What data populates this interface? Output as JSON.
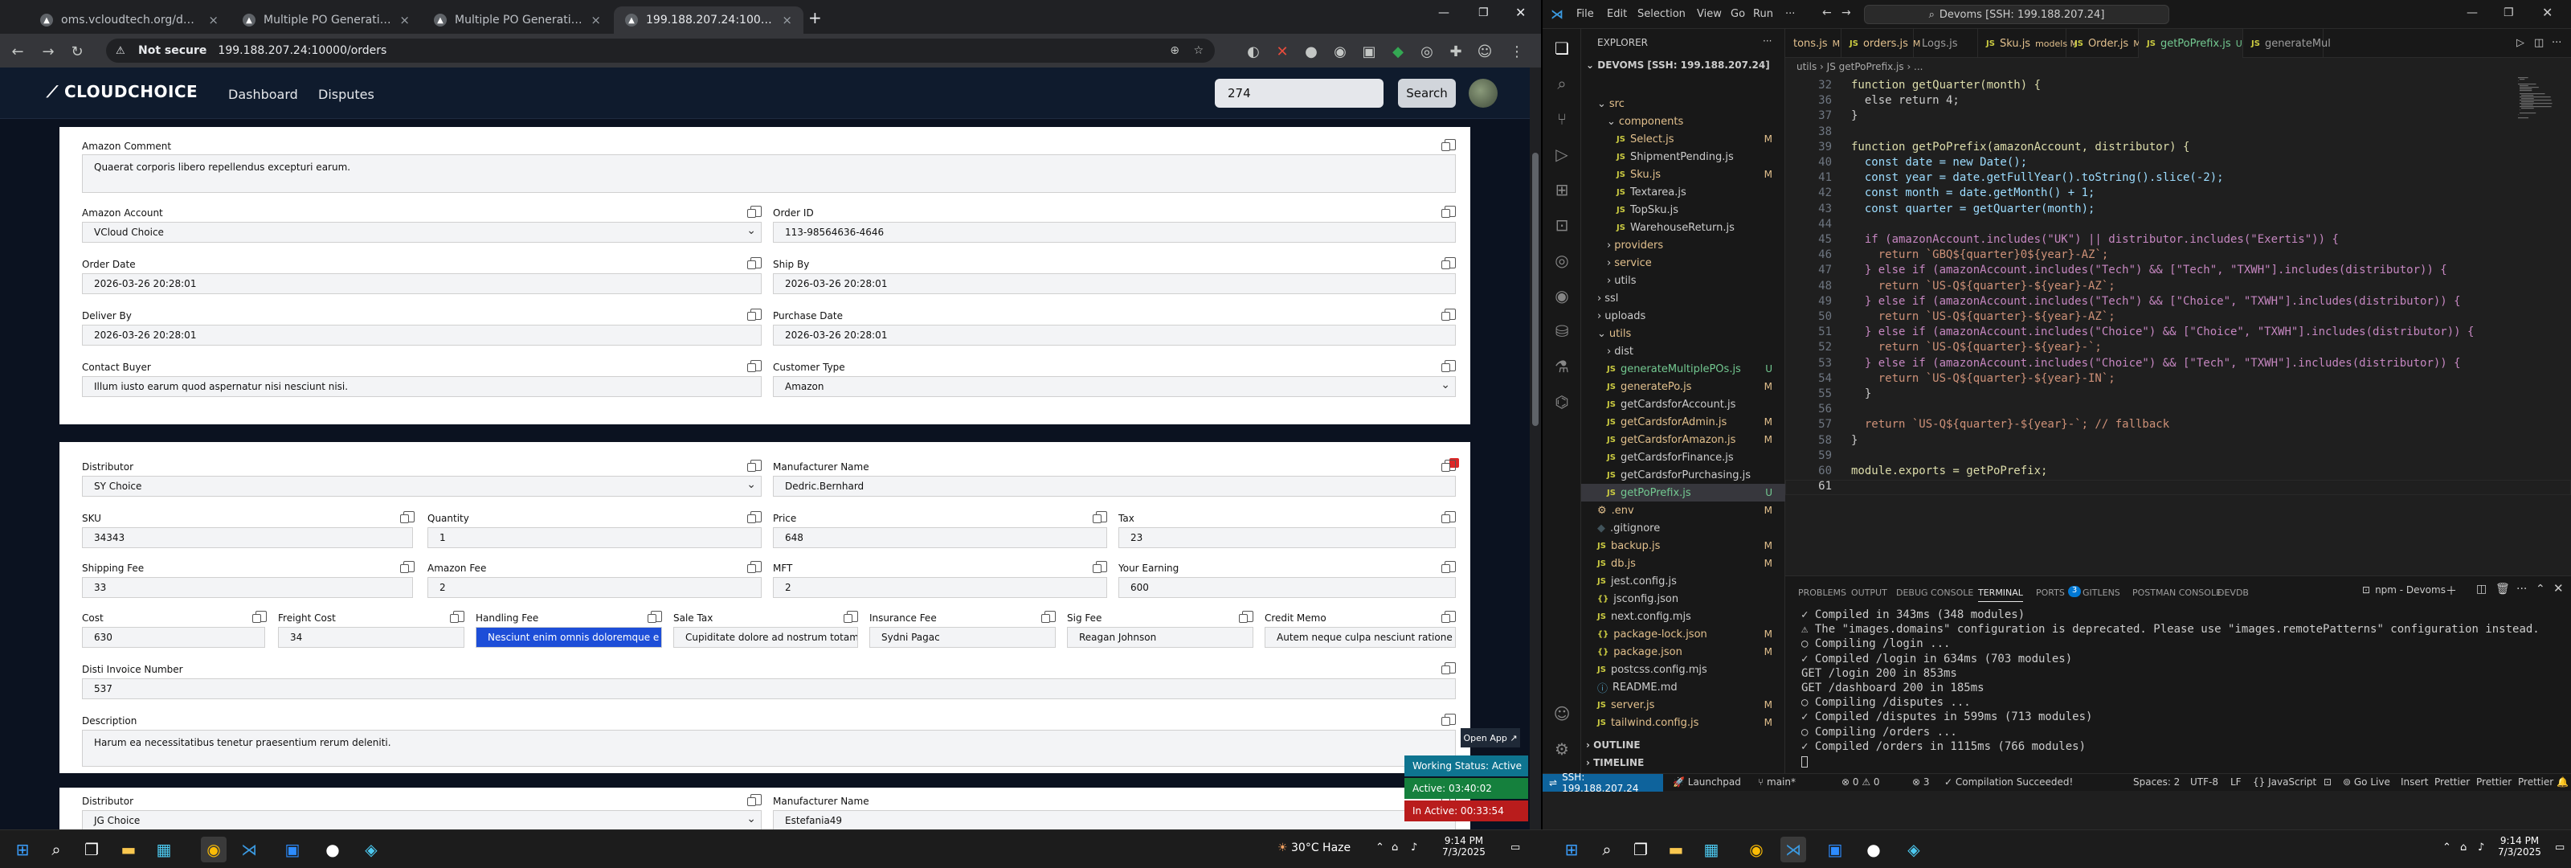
{
  "browser": {
    "tabs": [
      {
        "title": "oms.vcloudtech.org/dashboard",
        "active": false
      },
      {
        "title": "Multiple PO Generation",
        "active": false
      },
      {
        "title": "Multiple PO Generation",
        "active": false
      },
      {
        "title": "199.188.207.24:10000/orders",
        "active": true
      }
    ],
    "new_tab": "+",
    "not_secure": "Not secure",
    "url": "199.188.207.24:10000/orders"
  },
  "app": {
    "logo": "CLOUDCHOICE",
    "nav": [
      "Dashboard",
      "Disputes"
    ],
    "search_value": "274",
    "search_button": "Search",
    "section1": {
      "amazon_comment": {
        "label": "Amazon Comment",
        "value": "Quaerat corporis libero repellendus excepturi earum."
      },
      "amazon_account": {
        "label": "Amazon Account",
        "value": "VCloud Choice"
      },
      "order_id": {
        "label": "Order ID",
        "value": "113-98564636-4646"
      },
      "order_date": {
        "label": "Order Date",
        "value": "2026-03-26 20:28:01"
      },
      "ship_by": {
        "label": "Ship By",
        "value": "2026-03-26 20:28:01"
      },
      "deliver_by": {
        "label": "Deliver By",
        "value": "2026-03-26 20:28:01"
      },
      "purchase_date": {
        "label": "Purchase Date",
        "value": "2026-03-26 20:28:01"
      },
      "contact_buyer": {
        "label": "Contact Buyer",
        "value": "Illum iusto earum quod aspernatur nisi nesciunt nisi."
      },
      "customer_type": {
        "label": "Customer Type",
        "value": "Amazon"
      }
    },
    "section2": {
      "distributor": {
        "label": "Distributor",
        "value": "SY Choice"
      },
      "manufacturer_name": {
        "label": "Manufacturer Name",
        "value": "Dedric.Bernhard"
      },
      "sku": {
        "label": "SKU",
        "value": "34343"
      },
      "quantity": {
        "label": "Quantity",
        "value": "1"
      },
      "price": {
        "label": "Price",
        "value": "648"
      },
      "tax": {
        "label": "Tax",
        "value": "23"
      },
      "shipping_fee": {
        "label": "Shipping Fee",
        "value": "33"
      },
      "amazon_fee": {
        "label": "Amazon Fee",
        "value": "2"
      },
      "mft": {
        "label": "MFT",
        "value": "2"
      },
      "your_earning": {
        "label": "Your Earning",
        "value": "600"
      },
      "cost": {
        "label": "Cost",
        "value": "630"
      },
      "freight_cost": {
        "label": "Freight Cost",
        "value": "34"
      },
      "handling_fee": {
        "label": "Handling Fee",
        "value": "Nesciunt enim omnis doloremque e"
      },
      "sale_tax": {
        "label": "Sale Tax",
        "value": "Cupiditate dolore ad nostrum totam"
      },
      "insurance_fee": {
        "label": "Insurance Fee",
        "value": "Sydni Pagac"
      },
      "sig_fee": {
        "label": "Sig Fee",
        "value": "Reagan Johnson"
      },
      "credit_memo": {
        "label": "Credit Memo",
        "value": "Autem neque culpa nesciunt ratione"
      },
      "disti_invoice": {
        "label": "Disti Invoice Number",
        "value": "537"
      },
      "description": {
        "label": "Description",
        "value": "Harum ea necessitatibus tenetur praesentium rerum deleniti."
      }
    },
    "section3": {
      "distributor": {
        "label": "Distributor",
        "value": "JG Choice"
      },
      "manufacturer_name": {
        "label": "Manufacturer Name",
        "value": "Estefania49"
      }
    }
  },
  "widget": {
    "open_app": "Open App ↗",
    "working_status": "Working Status: Active",
    "active": "Active: 03:40:02",
    "inactive": "In Active: 00:33:54"
  },
  "vscode": {
    "menus": [
      "File",
      "Edit",
      "Selection",
      "View",
      "Go",
      "Run",
      "···"
    ],
    "command_center": "Devoms [SSH: 199.188.207.24]",
    "explorer_title": "EXPLORER",
    "root": "DEVOMS [SSH: 199.188.207.24]",
    "tree": [
      {
        "name": "src",
        "depth": 1,
        "type": "folder-open",
        "badge": "",
        "badge_color": "#e2c08d"
      },
      {
        "name": "components",
        "depth": 2,
        "type": "folder-open",
        "badge": "",
        "badge_color": "#e2c08d"
      },
      {
        "name": "Select.js",
        "depth": 3,
        "type": "js",
        "badge": "M",
        "badge_color": "#e2c08d"
      },
      {
        "name": "ShipmentPending.js",
        "depth": 3,
        "type": "js",
        "badge": "",
        "badge_color": ""
      },
      {
        "name": "Sku.js",
        "depth": 3,
        "type": "js",
        "badge": "M",
        "badge_color": "#e2c08d"
      },
      {
        "name": "Textarea.js",
        "depth": 3,
        "type": "js",
        "badge": "",
        "badge_color": ""
      },
      {
        "name": "TopSku.js",
        "depth": 3,
        "type": "js",
        "badge": "",
        "badge_color": ""
      },
      {
        "name": "WarehouseReturn.js",
        "depth": 3,
        "type": "js",
        "badge": "",
        "badge_color": ""
      },
      {
        "name": "providers",
        "depth": 2,
        "type": "folder",
        "badge": "",
        "badge_color": "#e2c08d"
      },
      {
        "name": "service",
        "depth": 2,
        "type": "folder",
        "badge": "",
        "badge_color": "#e2c08d"
      },
      {
        "name": "utils",
        "depth": 2,
        "type": "folder",
        "badge": "",
        "badge_color": ""
      },
      {
        "name": "ssl",
        "depth": 1,
        "type": "folder",
        "badge": "",
        "badge_color": ""
      },
      {
        "name": "uploads",
        "depth": 1,
        "type": "folder",
        "badge": "",
        "badge_color": ""
      },
      {
        "name": "utils",
        "depth": 1,
        "type": "folder-open",
        "badge": "",
        "badge_color": "#e2c08d"
      },
      {
        "name": "dist",
        "depth": 2,
        "type": "folder",
        "badge": "",
        "badge_color": ""
      },
      {
        "name": "generateMultiplePOs.js",
        "depth": 2,
        "type": "js",
        "badge": "U",
        "badge_color": "#73c991"
      },
      {
        "name": "generatePo.js",
        "depth": 2,
        "type": "js",
        "badge": "M",
        "badge_color": "#e2c08d"
      },
      {
        "name": "getCardsforAccount.js",
        "depth": 2,
        "type": "js",
        "badge": "",
        "badge_color": ""
      },
      {
        "name": "getCardsforAdmin.js",
        "depth": 2,
        "type": "js",
        "badge": "M",
        "badge_color": "#e2c08d"
      },
      {
        "name": "getCardsforAmazon.js",
        "depth": 2,
        "type": "js",
        "badge": "M",
        "badge_color": "#e2c08d"
      },
      {
        "name": "getCardsforFinance.js",
        "depth": 2,
        "type": "js",
        "badge": "",
        "badge_color": ""
      },
      {
        "name": "getCardsforPurchasing.js",
        "depth": 2,
        "type": "js",
        "badge": "",
        "badge_color": ""
      },
      {
        "name": "getPoPrefix.js",
        "depth": 2,
        "type": "js",
        "badge": "U",
        "badge_color": "#73c991"
      },
      {
        "name": ".env",
        "depth": 1,
        "type": "env",
        "badge": "M",
        "badge_color": "#e2c08d"
      },
      {
        "name": ".gitignore",
        "depth": 1,
        "type": "file",
        "badge": "",
        "badge_color": ""
      },
      {
        "name": "backup.js",
        "depth": 1,
        "type": "js",
        "badge": "M",
        "badge_color": "#e2c08d"
      },
      {
        "name": "db.js",
        "depth": 1,
        "type": "js",
        "badge": "M",
        "badge_color": "#e2c08d"
      },
      {
        "name": "jest.config.js",
        "depth": 1,
        "type": "js",
        "badge": "",
        "badge_color": ""
      },
      {
        "name": "jsconfig.json",
        "depth": 1,
        "type": "json",
        "badge": "",
        "badge_color": ""
      },
      {
        "name": "next.config.mjs",
        "depth": 1,
        "type": "js",
        "badge": "",
        "badge_color": ""
      },
      {
        "name": "package-lock.json",
        "depth": 1,
        "type": "json",
        "badge": "M",
        "badge_color": "#e2c08d"
      },
      {
        "name": "package.json",
        "depth": 1,
        "type": "json",
        "badge": "M",
        "badge_color": "#e2c08d"
      },
      {
        "name": "postcss.config.mjs",
        "depth": 1,
        "type": "js",
        "badge": "",
        "badge_color": ""
      },
      {
        "name": "README.md",
        "depth": 1,
        "type": "md",
        "badge": "",
        "badge_color": ""
      },
      {
        "name": "server.js",
        "depth": 1,
        "type": "js",
        "badge": "M",
        "badge_color": "#e2c08d"
      },
      {
        "name": "tailwind.config.js",
        "depth": 1,
        "type": "js",
        "badge": "M",
        "badge_color": "#e2c08d"
      }
    ],
    "outline": "OUTLINE",
    "timeline": "TIMELINE",
    "editor_tabs": [
      {
        "name": "tons.js",
        "badge": "M",
        "active": false
      },
      {
        "name": "orders.js",
        "badge": "M",
        "active": false
      },
      {
        "name": "Logs.js",
        "badge": "",
        "active": false
      },
      {
        "name": "Sku.js",
        "badge": "models M",
        "active": false
      },
      {
        "name": "Order.js",
        "badge": "M",
        "active": false
      },
      {
        "name": "getPoPrefix.js",
        "badge": "U",
        "active": true
      },
      {
        "name": "generateMul",
        "badge": "",
        "active": false
      }
    ],
    "breadcrumb": "utils  ›  JS getPoPrefix.js  ›  ...",
    "code_lines": [
      {
        "n": "32",
        "t": "function getQuarter(month) {"
      },
      {
        "n": "36",
        "t": "  else return 4;"
      },
      {
        "n": "37",
        "t": "}"
      },
      {
        "n": "38",
        "t": ""
      },
      {
        "n": "39",
        "t": "function getPoPrefix(amazonAccount, distributor) {"
      },
      {
        "n": "40",
        "t": "  const date = new Date();"
      },
      {
        "n": "41",
        "t": "  const year = date.getFullYear().toString().slice(-2);"
      },
      {
        "n": "42",
        "t": "  const month = date.getMonth() + 1;"
      },
      {
        "n": "43",
        "t": "  const quarter = getQuarter(month);"
      },
      {
        "n": "44",
        "t": ""
      },
      {
        "n": "45",
        "t": "  if (amazonAccount.includes(\"UK\") || distributor.includes(\"Exertis\")) {"
      },
      {
        "n": "46",
        "t": "    return `GBQ${quarter}0${year}-AZ`;"
      },
      {
        "n": "47",
        "t": "  } else if (amazonAccount.includes(\"Tech\") && [\"Tech\", \"TXWH\"].includes(distributor)) {"
      },
      {
        "n": "48",
        "t": "    return `US-Q${quarter}-${year}-AZ`;"
      },
      {
        "n": "49",
        "t": "  } else if (amazonAccount.includes(\"Tech\") && [\"Choice\", \"TXWH\"].includes(distributor)) {"
      },
      {
        "n": "50",
        "t": "    return `US-Q${quarter}-${year}-AZ`;"
      },
      {
        "n": "51",
        "t": "  } else if (amazonAccount.includes(\"Choice\") && [\"Choice\", \"TXWH\"].includes(distributor)) {"
      },
      {
        "n": "52",
        "t": "    return `US-Q${quarter}-${year}-`;"
      },
      {
        "n": "53",
        "t": "  } else if (amazonAccount.includes(\"Choice\") && [\"Tech\", \"TXWH\"].includes(distributor)) {"
      },
      {
        "n": "54",
        "t": "    return `US-Q${quarter}-${year}-IN`;"
      },
      {
        "n": "55",
        "t": "  }"
      },
      {
        "n": "56",
        "t": ""
      },
      {
        "n": "57",
        "t": "  return `US-Q${quarter}-${year}-`; // fallback"
      },
      {
        "n": "58",
        "t": "}"
      },
      {
        "n": "59",
        "t": ""
      },
      {
        "n": "60",
        "t": "module.exports = getPoPrefix;"
      },
      {
        "n": "61",
        "t": ""
      }
    ],
    "panel_tabs": [
      "PROBLEMS",
      "OUTPUT",
      "DEBUG CONSOLE",
      "TERMINAL",
      "PORTS",
      "GITLENS",
      "POSTMAN CONSOLE",
      "DEVDB"
    ],
    "ports_count": "3",
    "terminal_selector": "npm - Devoms",
    "terminal_lines": [
      "✓ Compiled in 343ms (348 modules)",
      "⚠ The \"images.domains\" configuration is deprecated. Please use \"images.remotePatterns\" configuration instead.",
      "○ Compiling /login ...",
      "✓ Compiled /login in 634ms (703 modules)",
      "GET /login 200 in 853ms",
      "GET /dashboard 200 in 185ms",
      "○ Compiling /disputes ...",
      "✓ Compiled /disputes in 599ms (713 modules)",
      "○ Compiling /orders ...",
      "✓ Compiled /orders in 1115ms (766 modules)"
    ],
    "status": {
      "remote": "SSH: 199.188.207.24",
      "launchpad": "Launchpad",
      "branch": "main*",
      "errors": "⊗ 0 ⚠ 0",
      "ports": "3",
      "compilation": "Compilation Succeeded!",
      "spaces": "Spaces: 2",
      "encoding": "UTF-8",
      "eol": "LF",
      "language": "{} JavaScript",
      "golive": "Go Live",
      "insert": "Insert",
      "prettier1": "Prettier",
      "prettier2": "Prettier",
      "prettier3": "Prettier"
    }
  },
  "taskbar": {
    "weather": "30°C  Haze",
    "time_left": "9:14 PM",
    "date_left": "7/3/2025",
    "time_right": "9:14 PM",
    "date_right": "7/3/2025"
  }
}
